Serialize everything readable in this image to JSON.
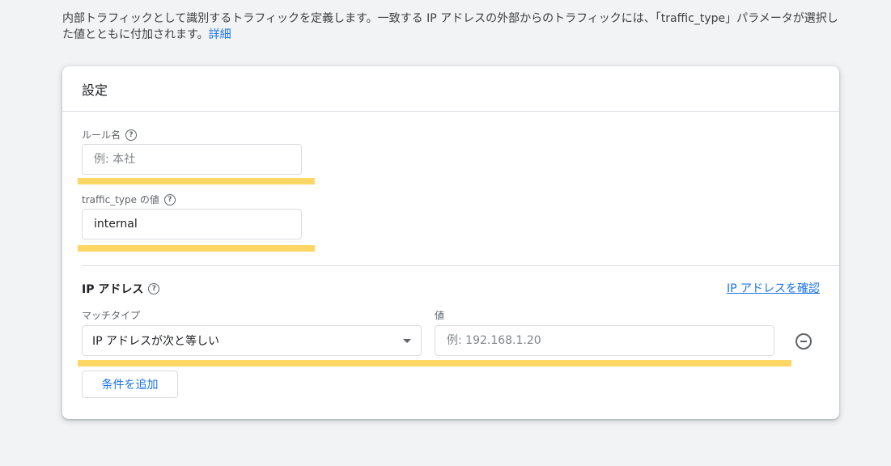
{
  "intro": {
    "text": "内部トラフィックとして識別するトラフィックを定義します。一致する IP アドレスの外部からのトラフィックには、「traffic_type」パラメータが選択した値とともに付加されます。",
    "link": "詳細"
  },
  "card": {
    "title": "設定",
    "rule_name": {
      "label": "ルール名",
      "placeholder": "例: 本社",
      "value": ""
    },
    "traffic_type": {
      "label": "traffic_type の値",
      "value": "internal"
    },
    "ip_section": {
      "title": "IP アドレス",
      "verify_link": "IP アドレスを確認",
      "match_type_label": "マッチタイプ",
      "match_type_value": "IP アドレスが次と等しい",
      "value_label": "値",
      "value_placeholder": "例: 192.168.1.20"
    },
    "add_condition": "条件を追加"
  },
  "colors": {
    "accent": "#1a73e8",
    "highlight": "#fdd663"
  }
}
